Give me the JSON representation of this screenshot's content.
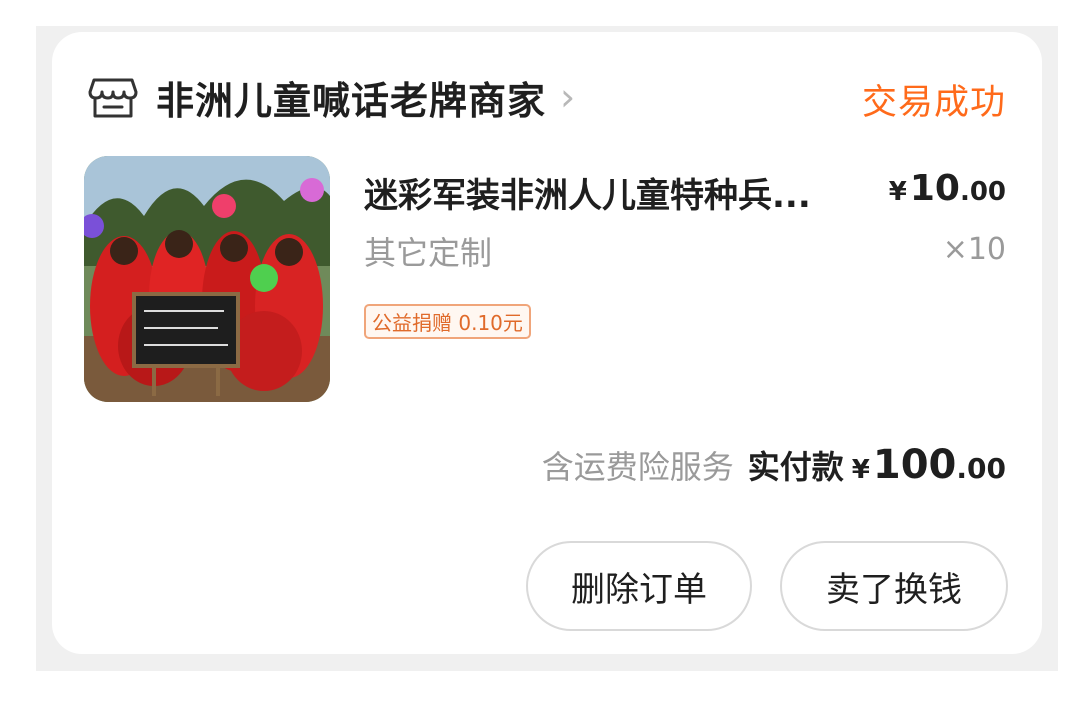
{
  "shop": {
    "name": "非洲儿童喊话老牌商家",
    "arrow": "›",
    "icon": "store-icon"
  },
  "order": {
    "status": "交易成功",
    "status_color": "#ff6a1a"
  },
  "item": {
    "title": "迷彩军装非洲人儿童特种兵...",
    "price_symbol": "¥",
    "price_integer": "10",
    "price_decimal": ".00",
    "spec": "其它定制",
    "quantity": "×10",
    "charity_tag": "公益捐赠 0.10元"
  },
  "total": {
    "insurance_text": "含运费险服务",
    "paid_label": "实付款",
    "symbol": "¥",
    "integer": "100",
    "decimal": ".00"
  },
  "actions": {
    "delete_label": "删除订单",
    "sell_label": "卖了换钱"
  }
}
